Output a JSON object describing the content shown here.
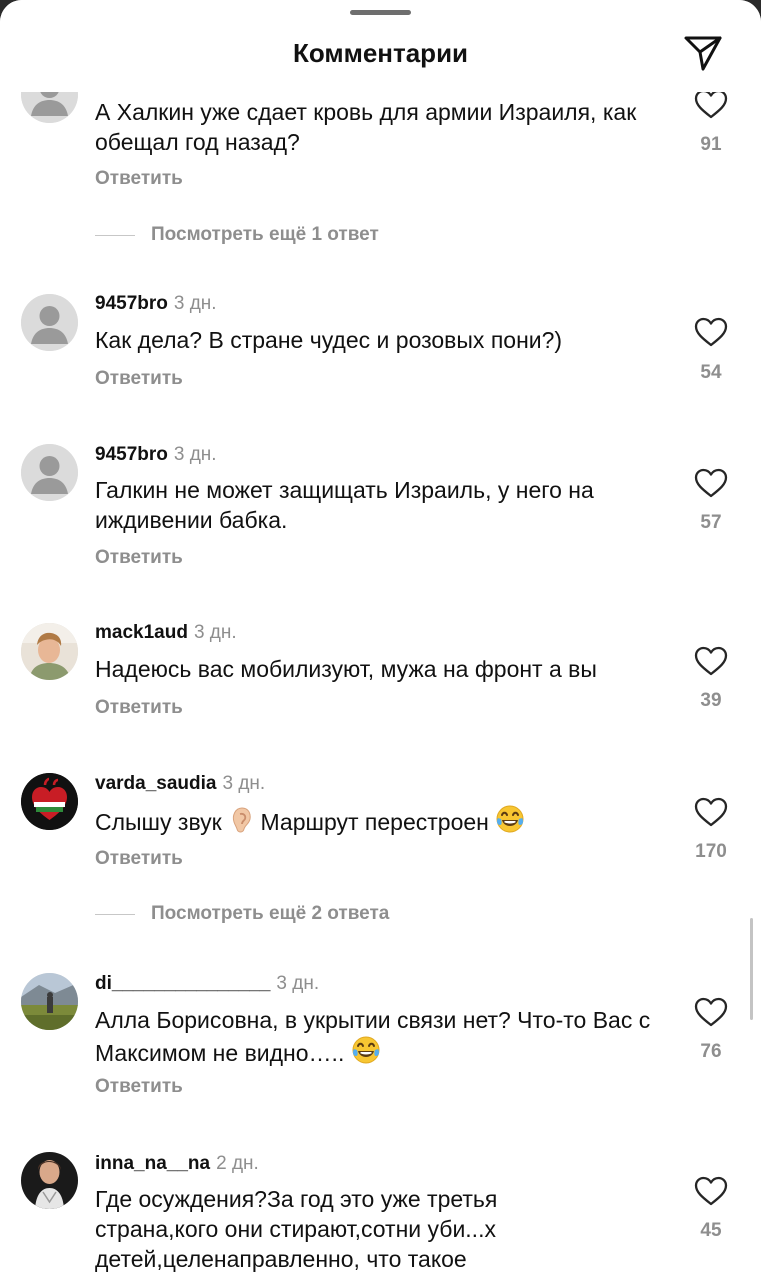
{
  "header": {
    "title": "Комментарии",
    "share_icon": "paper-plane-icon"
  },
  "comments": [
    {
      "text": "А Халкин уже сдает кровь для армии Израиля, как обещал год назад?",
      "reply_label": "Ответить",
      "likes": "91"
    },
    {
      "username": "9457bro",
      "time": "3 дн.",
      "text": "Как дела? В стране чудес и розовых пони?)",
      "reply_label": "Ответить",
      "likes": "54"
    },
    {
      "username": "9457bro",
      "time": "3 дн.",
      "text": "Галкин не может защищать Израиль, у него на иждивении бабка.",
      "reply_label": "Ответить",
      "likes": "57"
    },
    {
      "username": "mack1aud",
      "time": "3 дн.",
      "text": "Надеюсь вас мобилизуют, мужа на фронт а вы",
      "reply_label": "Ответить",
      "likes": "39"
    },
    {
      "username": "varda_saudia",
      "time": "3 дн.",
      "text_before": "Слышу звук ",
      "text_middle": " Маршрут перестроен ",
      "reply_label": "Ответить",
      "likes": "170"
    },
    {
      "username": "di_______________",
      "time": "3 дн.",
      "text": "Алла Борисовна, в укрытии связи нет? Что-то Вас с Максимом не видно….. ",
      "reply_label": "Ответить",
      "likes": "76"
    },
    {
      "username": "inna_na__na",
      "time": "2 дн.",
      "text": "Где осуждения?За год это уже третья страна,кого они стирают,сотни уби...х детей,целенаправленно, что такое",
      "likes": "45"
    }
  ],
  "view_more": [
    {
      "label": "Посмотреть ещё 1 ответ"
    },
    {
      "label": "Посмотреть ещё 2 ответа"
    }
  ],
  "colors": {
    "text": "#111111",
    "secondary": "#8e8e8e",
    "background": "#ffffff"
  }
}
